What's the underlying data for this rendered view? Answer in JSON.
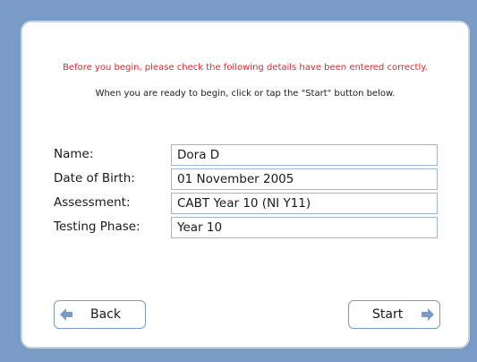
{
  "header": {
    "warning": "Before you begin, please check the following details have been entered correctly.",
    "instruction": "When you are ready to begin, click or tap the \"Start\" button below."
  },
  "details": [
    {
      "label": "Name:",
      "value": "Dora D"
    },
    {
      "label": "Date of Birth:",
      "value": "01 November 2005"
    },
    {
      "label": "Assessment:",
      "value": "CABT Year 10 (NI Y11)"
    },
    {
      "label": "Testing Phase:",
      "value": "Year 10"
    }
  ],
  "buttons": {
    "back_label": "Back",
    "start_label": "Start"
  },
  "colors": {
    "background": "#7a9bc6",
    "warning_text": "#e8202a",
    "field_border": "#9db4d2",
    "arrow": "#7a9bc6"
  },
  "icons": {
    "back": "arrow-left-icon",
    "start": "arrow-right-icon"
  }
}
